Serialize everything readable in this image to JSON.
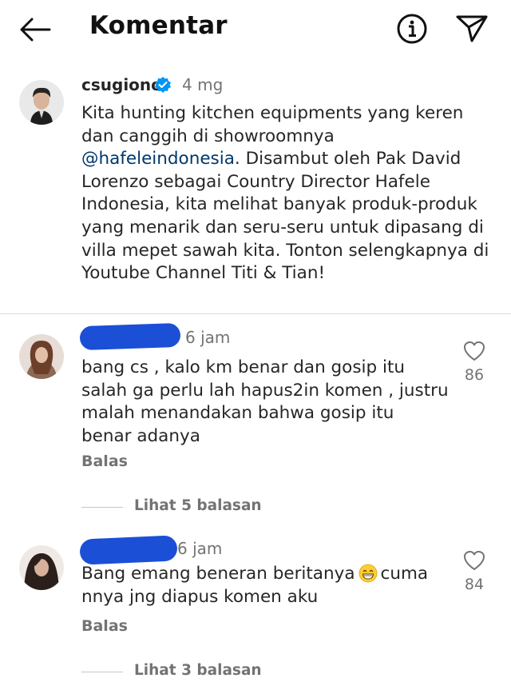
{
  "header": {
    "title": "Komentar",
    "back_icon": "arrow-left-icon",
    "info_icon": "info-circle-icon",
    "send_icon": "paper-plane-icon"
  },
  "post": {
    "username": "csugiono",
    "verified": true,
    "time": "4 mg",
    "caption_before": "Kita hunting kitchen equipments yang keren dan canggih di showroomnya ",
    "mention": "@hafeleindonesia",
    "caption_after": ". Disambut oleh Pak David Lorenzo sebagai Country Director Hafele Indonesia, kita melihat banyak produk-produk yang menarik dan seru-seru untuk dipasang di villa mepet sawah kita. Tonton selengkapnya di Youtube Channel Titi & Tian!"
  },
  "comments": [
    {
      "time": "6 jam",
      "text": "bang cs , kalo km benar dan gosip itu salah ga perlu lah hapus2in komen , justru malah menandakan bahwa gosip itu benar adanya",
      "likes": "86",
      "reply_label": "Balas",
      "view_replies": "Lihat 5 balasan"
    },
    {
      "time": "6 jam",
      "text_before_emoji": "Bang emang beneran beritanya",
      "emoji": "grinning-face-emoji",
      "text_after_emoji": "cuma nnya jng diapus komen aku",
      "likes": "84",
      "reply_label": "Balas",
      "view_replies": "Lihat 3 balasan"
    }
  ],
  "colors": {
    "text": "#262626",
    "secondary": "#737373",
    "mention": "#00376b",
    "verified": "#0095f6",
    "redaction": "#1a4fd6"
  }
}
